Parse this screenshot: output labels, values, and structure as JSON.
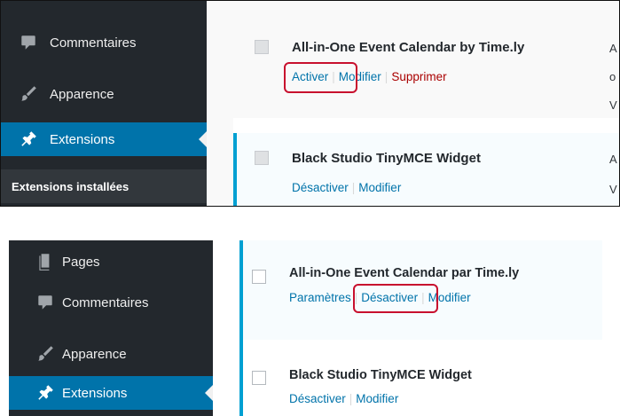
{
  "top": {
    "sidebar": {
      "items": [
        {
          "label": "Commentaires",
          "icon": "comment-icon"
        },
        {
          "label": "Apparence",
          "icon": "brush-icon"
        },
        {
          "label": "Extensions",
          "icon": "plugin-icon",
          "active": true
        }
      ],
      "submenu_label": "Extensions installées"
    },
    "plugins": [
      {
        "title": "All-in-One Event Calendar by Time.ly",
        "actions": {
          "activate": "Activer",
          "edit": "Modifier",
          "delete": "Supprimer"
        },
        "status": "inactive",
        "col_trunc": [
          "A",
          "o",
          "V"
        ]
      },
      {
        "title": "Black Studio TinyMCE Widget",
        "actions": {
          "deactivate": "Désactiver",
          "edit": "Modifier"
        },
        "status": "active",
        "col_trunc": [
          "A",
          "V"
        ]
      }
    ]
  },
  "bottom": {
    "sidebar": {
      "items": [
        {
          "label": "Pages",
          "icon": "pages-icon"
        },
        {
          "label": "Commentaires",
          "icon": "comment-icon"
        },
        {
          "label": "Apparence",
          "icon": "brush-icon"
        },
        {
          "label": "Extensions",
          "icon": "plugin-icon",
          "active": true
        }
      ]
    },
    "plugins": [
      {
        "title": "All-in-One Event Calendar par Time.ly",
        "actions": {
          "settings": "Paramètres",
          "deactivate": "Désactiver",
          "edit": "Modifier"
        },
        "status": "active"
      },
      {
        "title": "Black Studio TinyMCE Widget",
        "actions": {
          "deactivate": "Désactiver",
          "edit": "Modifier"
        },
        "status": "active"
      }
    ]
  },
  "colors": {
    "sidebar_bg": "#23282d",
    "accent": "#0073aa",
    "highlight": "#c8102e",
    "delete": "#aa0000"
  }
}
